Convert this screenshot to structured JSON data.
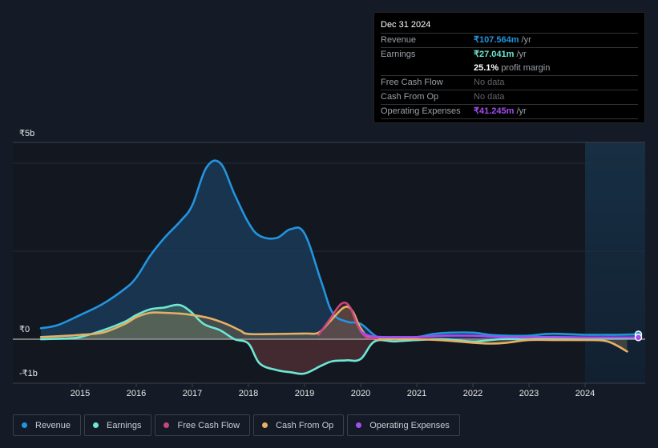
{
  "tooltip": {
    "date": "Dec 31 2024",
    "rows": [
      {
        "label": "Revenue",
        "value": "₹107.564m",
        "unit": "/yr",
        "color": "#2394df"
      },
      {
        "label": "Earnings",
        "value": "₹27.041m",
        "unit": "/yr",
        "color": "#6ee7d5"
      },
      {
        "label": "",
        "value": "25.1%",
        "unit": "profit margin",
        "color": "#ffffff"
      },
      {
        "label": "Free Cash Flow",
        "value": "No data",
        "unit": "",
        "color": ""
      },
      {
        "label": "Cash From Op",
        "value": "No data",
        "unit": "",
        "color": ""
      },
      {
        "label": "Operating Expenses",
        "value": "₹41.245m",
        "unit": "/yr",
        "color": "#a34ded"
      }
    ]
  },
  "legend": [
    {
      "label": "Revenue",
      "color": "#2394df"
    },
    {
      "label": "Earnings",
      "color": "#6ee7d5"
    },
    {
      "label": "Free Cash Flow",
      "color": "#c8467e"
    },
    {
      "label": "Cash From Op",
      "color": "#e7b063"
    },
    {
      "label": "Operating Expenses",
      "color": "#a34ded"
    }
  ],
  "chart_data": {
    "type": "area",
    "title": "",
    "xlabel": "",
    "ylabel": "",
    "y_tick_labels": [
      "₹5b",
      "₹0",
      "-₹1b"
    ],
    "x_tick_labels": [
      "2015",
      "2016",
      "2017",
      "2018",
      "2019",
      "2020",
      "2021",
      "2022",
      "2023",
      "2024"
    ],
    "xlim": [
      2014.3,
      2025.0
    ],
    "ylim": [
      -1.0,
      4.5
    ],
    "units": "₹ billions",
    "highlight_region": [
      2024.0,
      2025.0
    ],
    "grid": true,
    "legend_position": "bottom",
    "series": [
      {
        "name": "Revenue",
        "color": "#2394df",
        "x": [
          2014.3,
          2014.6,
          2015.0,
          2015.4,
          2015.8,
          2016.0,
          2016.25,
          2016.5,
          2016.8,
          2017.0,
          2017.25,
          2017.5,
          2017.75,
          2018.0,
          2018.2,
          2018.5,
          2018.75,
          2019.0,
          2019.3,
          2019.5,
          2019.75,
          2020.0,
          2020.3,
          2020.6,
          2021.0,
          2021.3,
          2021.6,
          2022.0,
          2022.3,
          2022.6,
          2023.0,
          2023.3,
          2023.6,
          2024.0,
          2024.3,
          2024.6,
          2024.95
        ],
        "y": [
          0.25,
          0.32,
          0.55,
          0.8,
          1.15,
          1.4,
          1.9,
          2.3,
          2.7,
          3.05,
          3.9,
          4.0,
          3.3,
          2.65,
          2.35,
          2.3,
          2.5,
          2.4,
          1.3,
          0.6,
          0.4,
          0.35,
          0.05,
          0.05,
          0.05,
          0.12,
          0.15,
          0.15,
          0.1,
          0.08,
          0.08,
          0.12,
          0.12,
          0.1,
          0.1,
          0.1,
          0.11
        ]
      },
      {
        "name": "Earnings",
        "color": "#6ee7d5",
        "x": [
          2014.3,
          2014.8,
          2015.0,
          2015.4,
          2015.8,
          2016.0,
          2016.25,
          2016.5,
          2016.75,
          2016.95,
          2017.2,
          2017.5,
          2017.75,
          2018.0,
          2018.2,
          2018.5,
          2018.75,
          2019.0,
          2019.3,
          2019.5,
          2019.75,
          2020.0,
          2020.25,
          2020.6,
          2021.0,
          2021.5,
          2022.0,
          2022.5,
          2023.0,
          2023.5,
          2024.0,
          2024.5,
          2024.95
        ],
        "y": [
          0.0,
          0.02,
          0.05,
          0.2,
          0.4,
          0.55,
          0.68,
          0.72,
          0.78,
          0.65,
          0.35,
          0.2,
          0.0,
          -0.1,
          -0.55,
          -0.7,
          -0.75,
          -0.78,
          -0.6,
          -0.5,
          -0.48,
          -0.45,
          -0.05,
          -0.05,
          -0.02,
          0.0,
          -0.05,
          0.0,
          0.0,
          0.02,
          0.02,
          0.02,
          0.03
        ]
      },
      {
        "name": "Free Cash Flow",
        "color": "#c8467e",
        "x": [
          2019.25,
          2019.45,
          2019.65,
          2019.8,
          2019.95,
          2020.1,
          2020.3
        ],
        "y": [
          0.1,
          0.45,
          0.8,
          0.75,
          0.3,
          0.05,
          0.02
        ]
      },
      {
        "name": "Cash From Op",
        "color": "#e7b063",
        "x": [
          2014.3,
          2014.8,
          2015.0,
          2015.4,
          2015.8,
          2016.0,
          2016.25,
          2016.5,
          2016.8,
          2017.0,
          2017.3,
          2017.6,
          2017.85,
          2018.0,
          2018.5,
          2019.0,
          2019.25,
          2019.45,
          2019.7,
          2019.85,
          2020.0,
          2020.2,
          2020.6,
          2021.0,
          2021.5,
          2022.0,
          2022.3,
          2022.6,
          2023.0,
          2023.5,
          2024.0,
          2024.3,
          2024.5,
          2024.75
        ],
        "y": [
          0.05,
          0.08,
          0.1,
          0.15,
          0.35,
          0.5,
          0.6,
          0.6,
          0.58,
          0.55,
          0.48,
          0.35,
          0.2,
          0.12,
          0.12,
          0.13,
          0.15,
          0.4,
          0.72,
          0.65,
          0.25,
          0.02,
          0.0,
          0.0,
          -0.03,
          -0.08,
          -0.1,
          -0.08,
          -0.02,
          -0.02,
          -0.02,
          -0.03,
          -0.1,
          -0.28
        ]
      },
      {
        "name": "Operating Expenses",
        "color": "#a34ded",
        "x": [
          2020.0,
          2020.15,
          2020.4,
          2021.0,
          2021.5,
          2022.0,
          2022.5,
          2023.0,
          2023.5,
          2024.0,
          2024.5,
          2024.95
        ],
        "y": [
          0.18,
          0.08,
          0.05,
          0.05,
          0.08,
          0.08,
          0.05,
          0.05,
          0.05,
          0.04,
          0.04,
          0.04
        ]
      }
    ]
  }
}
